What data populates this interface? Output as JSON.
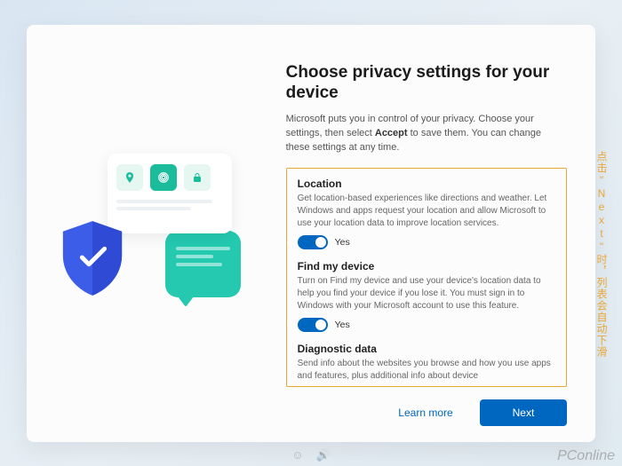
{
  "title": "Choose privacy settings for your device",
  "subtitle_pre": "Microsoft puts you in control of your privacy. Choose your settings, then select ",
  "subtitle_bold": "Accept",
  "subtitle_post": " to save them. You can change these settings at any time.",
  "settings": [
    {
      "name": "Location",
      "desc": "Get location-based experiences like directions and weather. Let Windows and apps request your location and allow Microsoft to use your location data to improve location services.",
      "toggle_state": "on",
      "toggle_label": "Yes"
    },
    {
      "name": "Find my device",
      "desc": "Turn on Find my device and use your device's location data to help you find your device if you lose it. You must sign in to Windows with your Microsoft account to use this feature.",
      "toggle_state": "on",
      "toggle_label": "Yes"
    },
    {
      "name": "Diagnostic data",
      "desc": "Send info about the websites you browse and how you use apps and features, plus additional info about device",
      "toggle_state": "hidden",
      "toggle_label": ""
    }
  ],
  "buttons": {
    "secondary": "Learn more",
    "primary": "Next"
  },
  "annotation": "点击\"Next\"时，列表会自动下滑",
  "watermark": "PConline"
}
